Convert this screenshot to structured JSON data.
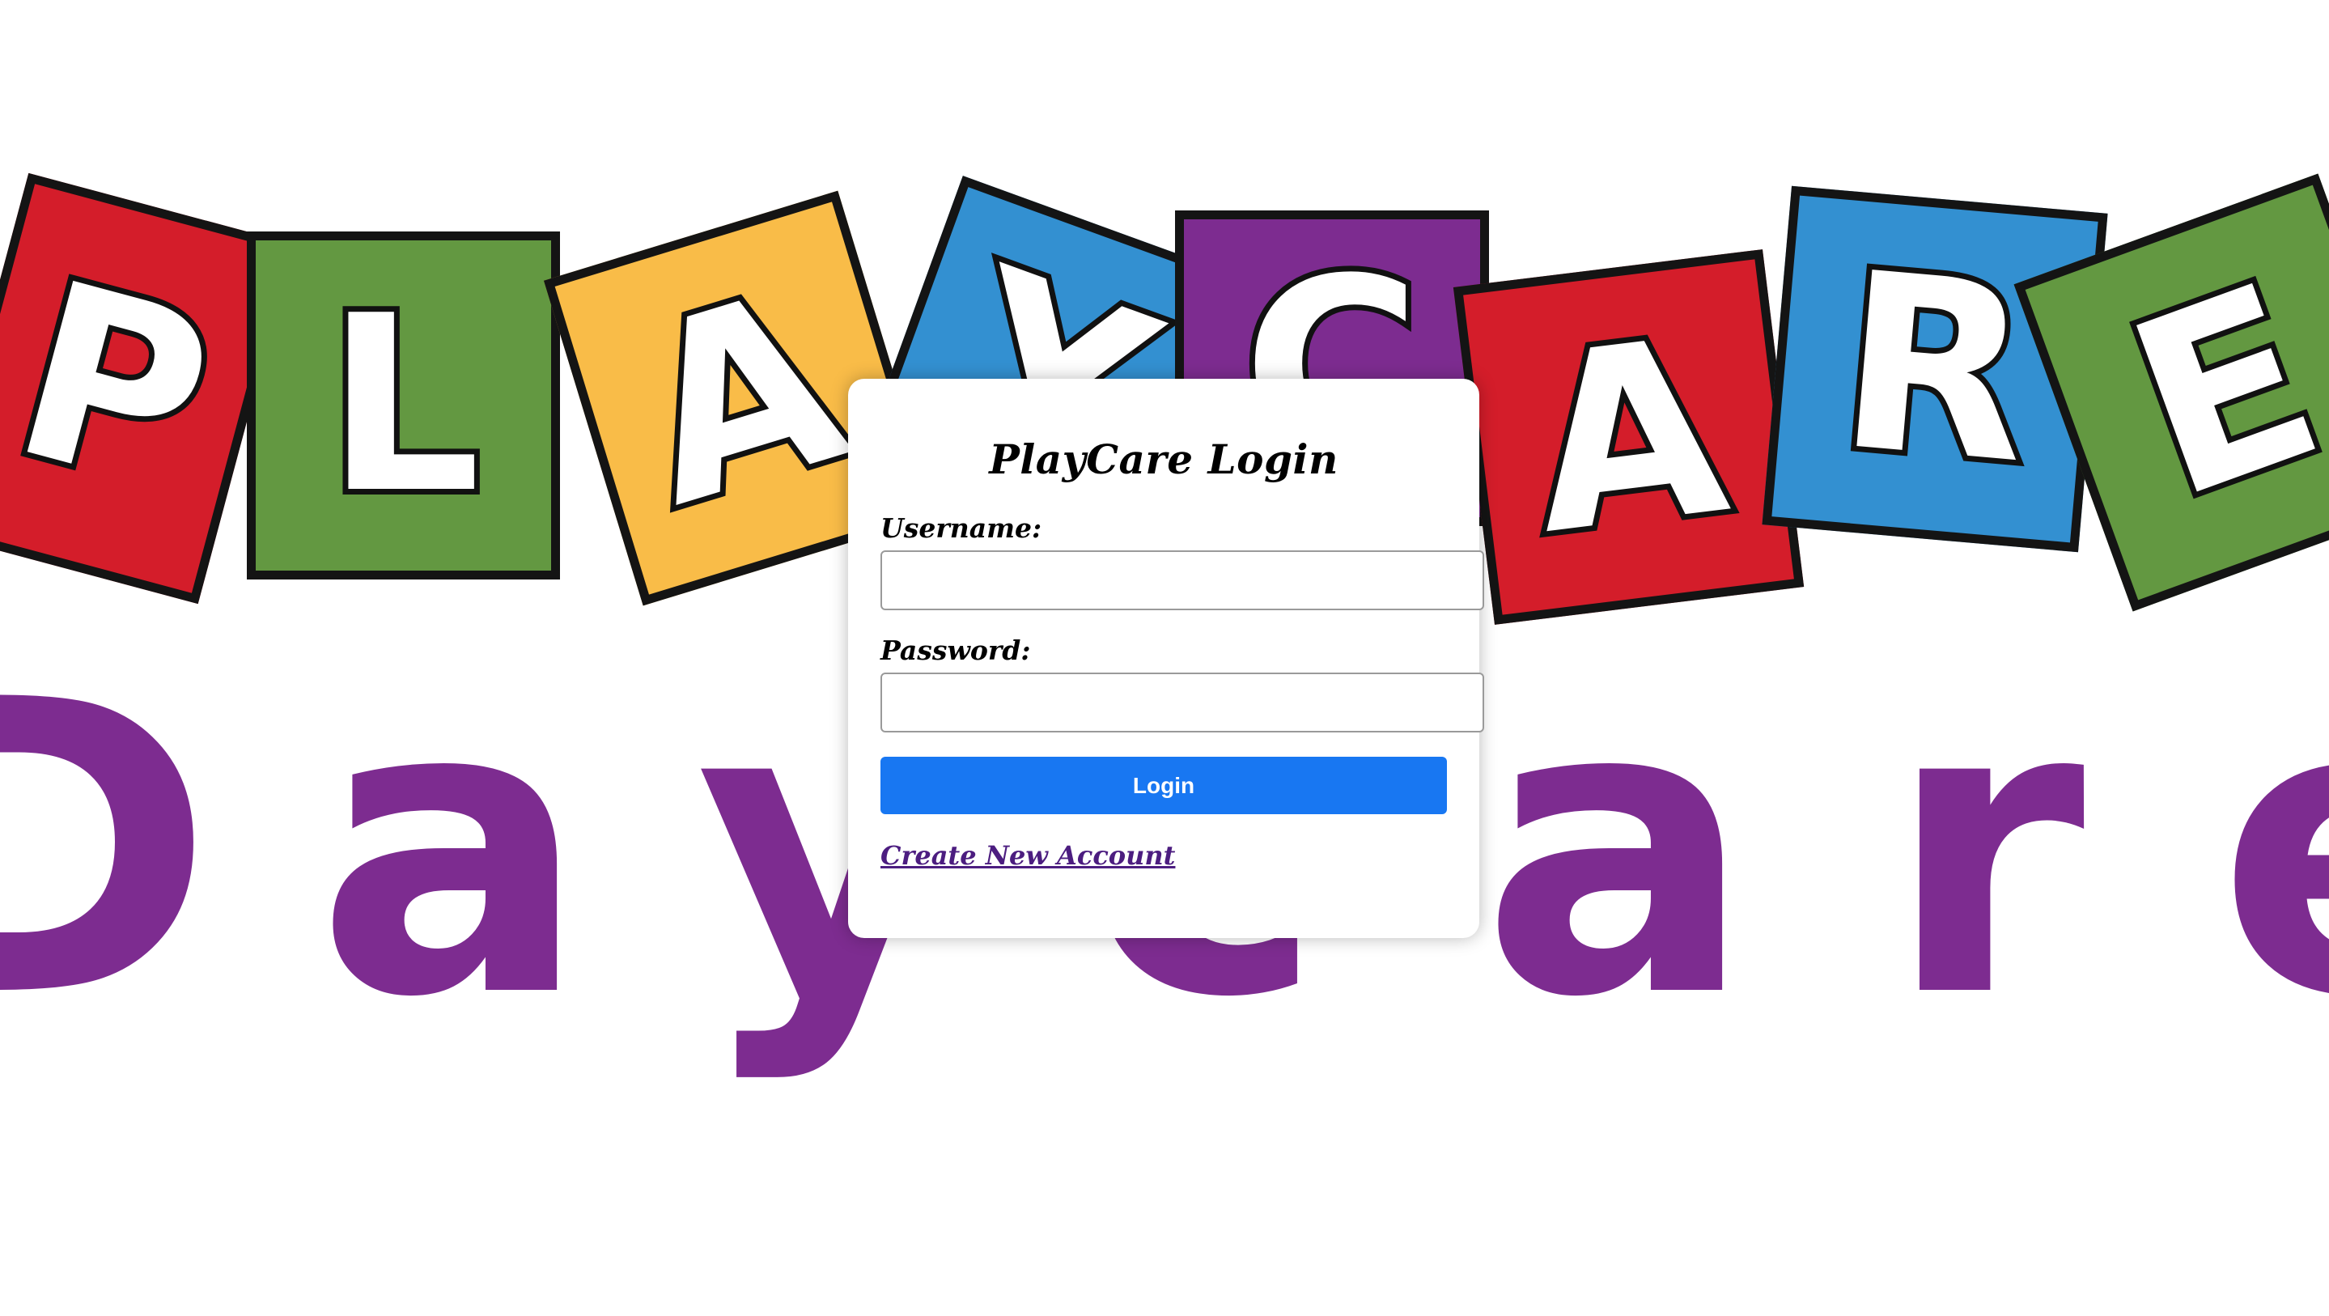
{
  "background": {
    "logo_tiles": [
      {
        "letter": "P",
        "color": "#d41d2a"
      },
      {
        "letter": "L",
        "color": "#639841"
      },
      {
        "letter": "A",
        "color": "#f9bc48"
      },
      {
        "letter": "Y",
        "color": "#3390d1"
      },
      {
        "letter": "C",
        "color": "#7d2c90"
      },
      {
        "letter": "A",
        "color": "#d41d2a"
      },
      {
        "letter": "R",
        "color": "#3390d1"
      },
      {
        "letter": "E",
        "color": "#639841"
      }
    ],
    "daycare_letters": [
      "D",
      "a",
      "y",
      "c",
      "a",
      "r",
      "e"
    ],
    "daycare_color": "#7d2c90"
  },
  "login": {
    "title": "PlayCare Login",
    "username_label": "Username:",
    "username_value": "",
    "password_label": "Password:",
    "password_value": "",
    "button_label": "Login",
    "button_color": "#1877f2",
    "create_account_label": "Create New Account",
    "link_color": "#4c1d80"
  }
}
